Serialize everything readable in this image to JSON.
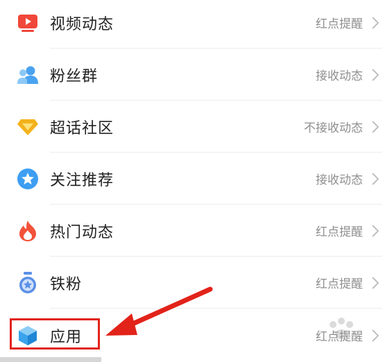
{
  "settings": {
    "items": [
      {
        "label": "视频动态",
        "value": "红点提醒",
        "icon": "video-play-icon",
        "color": "#f0473a"
      },
      {
        "label": "粉丝群",
        "value": "接收动态",
        "icon": "group-users-icon",
        "color": "#4aa3f0"
      },
      {
        "label": "超话社区",
        "value": "不接收动态",
        "icon": "diamond-icon",
        "color": "#f3b21c"
      },
      {
        "label": "关注推荐",
        "value": "接收动态",
        "icon": "star-badge-icon",
        "color": "#3d9ef2"
      },
      {
        "label": "热门动态",
        "value": "红点提醒",
        "icon": "flame-icon",
        "color": "#f2533a"
      },
      {
        "label": "铁粉",
        "value": "红点提醒",
        "icon": "medal-icon",
        "color": "#5b8fe6"
      },
      {
        "label": "应用",
        "value": "红点提醒",
        "icon": "cube-icon",
        "color": "#3aa3ec"
      }
    ]
  },
  "annotation": {
    "highlight_color": "#e2231a"
  }
}
